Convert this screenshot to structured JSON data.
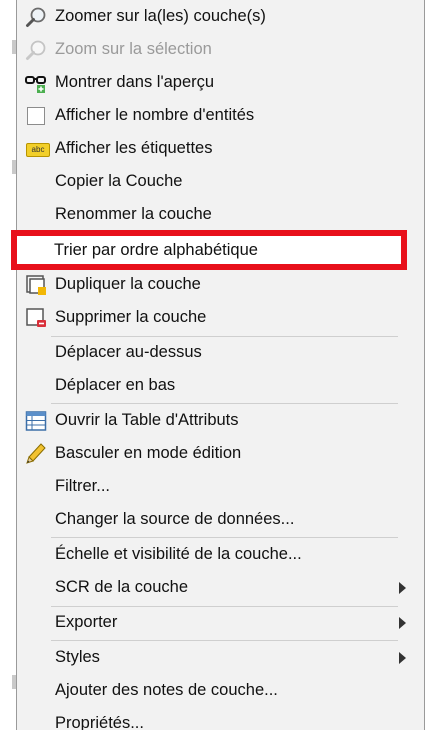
{
  "menu": {
    "items": [
      {
        "label": "Zoomer sur la(les) couche(s)",
        "icon": "zoom-layer-icon",
        "disabled": false
      },
      {
        "label": "Zoom sur la sélection",
        "icon": "zoom-selection-icon",
        "disabled": true
      },
      {
        "label": "Montrer dans l'aperçu",
        "icon": "overview-glasses-icon",
        "disabled": false
      },
      {
        "label": "Afficher le nombre d'entités",
        "icon": "checkbox-icon",
        "disabled": false
      },
      {
        "label": "Afficher les étiquettes",
        "icon": "label-abc-icon",
        "disabled": false
      },
      {
        "label": "Copier la Couche",
        "icon": "",
        "disabled": false
      },
      {
        "label": "Renommer la couche",
        "icon": "",
        "disabled": false
      },
      {
        "label": "Trier par ordre alphabétique",
        "icon": "",
        "disabled": false,
        "highlighted": true
      },
      {
        "label": "Dupliquer la couche",
        "icon": "duplicate-layer-icon",
        "disabled": false
      },
      {
        "label": "Supprimer la couche",
        "icon": "remove-layer-icon",
        "disabled": false
      },
      {
        "label": "Déplacer au-dessus",
        "icon": "",
        "disabled": false
      },
      {
        "label": "Déplacer en bas",
        "icon": "",
        "disabled": false
      },
      {
        "label": "Ouvrir la Table d'Attributs",
        "icon": "attribute-table-icon",
        "disabled": false
      },
      {
        "label": "Basculer en mode édition",
        "icon": "pencil-icon",
        "disabled": false
      },
      {
        "label": "Filtrer...",
        "icon": "",
        "disabled": false
      },
      {
        "label": "Changer la source de données...",
        "icon": "",
        "disabled": false
      },
      {
        "label": "Échelle et visibilité de la couche...",
        "icon": "",
        "disabled": false
      },
      {
        "label": "SCR de la couche",
        "icon": "",
        "disabled": false,
        "submenu": true
      },
      {
        "label": "Exporter",
        "icon": "",
        "disabled": false,
        "submenu": true
      },
      {
        "label": "Styles",
        "icon": "",
        "disabled": false,
        "submenu": true
      },
      {
        "label": "Ajouter des notes de couche...",
        "icon": "",
        "disabled": false
      },
      {
        "label": "Propriétés...",
        "icon": "",
        "disabled": false
      }
    ]
  },
  "colors": {
    "menu_background": "#f2f2f2",
    "highlight_border": "#e8101b",
    "disabled_text": "#9a9a9a"
  }
}
